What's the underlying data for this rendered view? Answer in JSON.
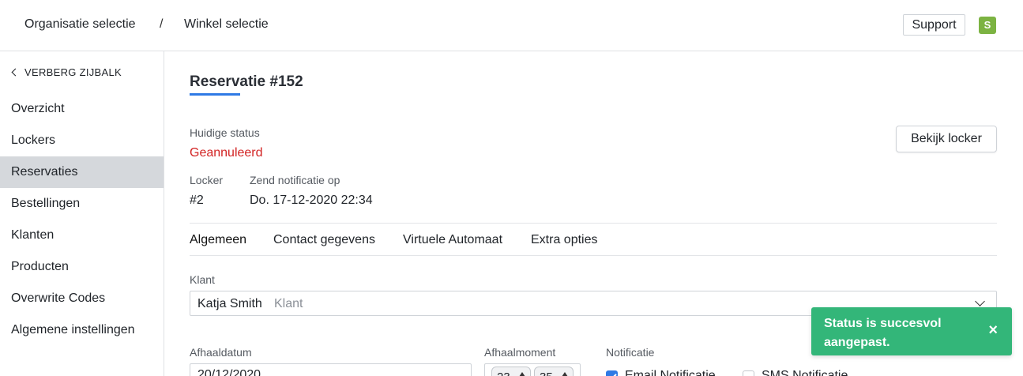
{
  "header": {
    "breadcrumb": [
      "Organisatie selectie",
      "Winkel selectie"
    ],
    "separator": "/",
    "support_label": "Support",
    "avatar_initial": "S"
  },
  "sidebar": {
    "hide_label": "VERBERG ZIJBALK",
    "active_item": "Reservaties",
    "items": [
      {
        "label": "Overzicht"
      },
      {
        "label": "Lockers"
      },
      {
        "label": "Reservaties"
      },
      {
        "label": "Bestellingen"
      },
      {
        "label": "Klanten"
      },
      {
        "label": "Producten"
      },
      {
        "label": "Overwrite Codes"
      },
      {
        "label": "Algemene instellingen"
      }
    ]
  },
  "reservation": {
    "title": "Reservatie #152",
    "status_label": "Huidige status",
    "status_value": "Geannuleerd",
    "view_locker_label": "Bekijk locker",
    "locker_label": "Locker",
    "locker_value": "#2",
    "notify_label": "Zend notificatie op",
    "notify_value": "Do. 17-12-2020 22:34"
  },
  "tabs": [
    {
      "label": "Algemeen",
      "active": true
    },
    {
      "label": "Contact gegevens"
    },
    {
      "label": "Virtuele Automaat"
    },
    {
      "label": "Extra opties"
    }
  ],
  "form": {
    "customer_label": "Klant",
    "customer_value": "Katja Smith",
    "customer_placeholder": "Klant",
    "pickup_date_label": "Afhaaldatum",
    "pickup_date_value": "20/12/2020",
    "pickup_time_label": "Afhaalmoment",
    "pickup_hour": "23",
    "pickup_minute": "35",
    "notification_label": "Notificatie",
    "email_notification_label": "Email Notificatie",
    "email_notification_checked": true,
    "sms_notification_label": "SMS Notificatie",
    "sms_notification_checked": false
  },
  "toast": {
    "message": "Status is succesvol aangepast.",
    "close_glyph": "×"
  },
  "colors": {
    "accent": "#2f7ae5",
    "status_cancelled": "#d22323",
    "toast": "#33b679",
    "avatar": "#7cb342",
    "active_nav": "#d5d8dc"
  }
}
